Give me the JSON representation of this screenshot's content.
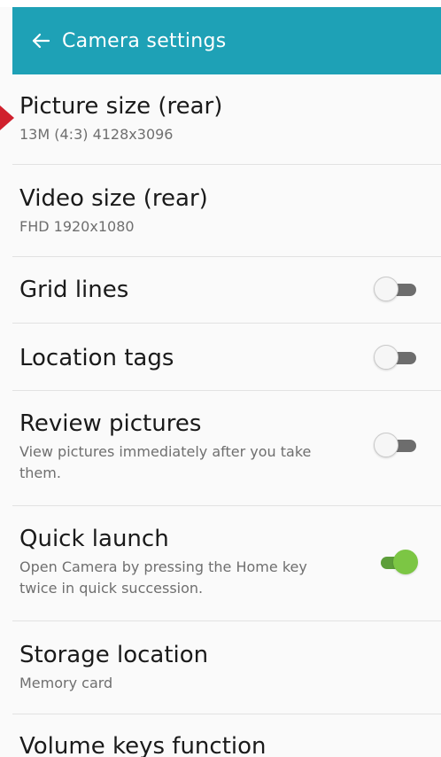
{
  "header": {
    "title": "Camera settings",
    "background_color": "#1ea1b6",
    "back_icon": "arrow-left-icon"
  },
  "settings": [
    {
      "title": "Picture size (rear)",
      "subtitle": "13M (4:3) 4128x3096"
    },
    {
      "title": "Video size (rear)",
      "subtitle": "FHD 1920x1080"
    },
    {
      "title": "Grid lines",
      "toggle": false
    },
    {
      "title": "Location tags",
      "toggle": false
    },
    {
      "title": "Review pictures",
      "subtitle": "View pictures immediately after you take them.",
      "toggle": false
    },
    {
      "title": "Quick launch",
      "subtitle": "Open Camera by pressing the Home key twice in quick succession.",
      "toggle": true
    },
    {
      "title": "Storage location",
      "subtitle": "Memory card"
    },
    {
      "title": "Volume keys function"
    }
  ],
  "colors": {
    "toggle_on": "#7cc644",
    "toggle_off_track": "#6d6d6d",
    "pointer": "#d0202d"
  }
}
